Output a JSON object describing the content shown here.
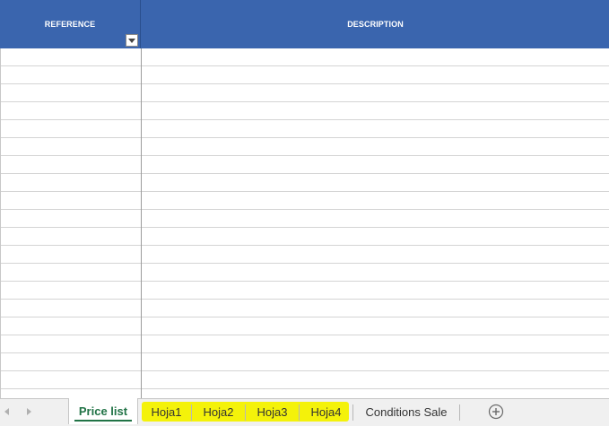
{
  "header": {
    "reference_label": "REFERENCE",
    "description_label": "DESCRIPTION",
    "header_color": "#3a65ae"
  },
  "tabs": {
    "active": "Price list",
    "items": [
      {
        "label": "Price list"
      },
      {
        "label": "Hoja1"
      },
      {
        "label": "Hoja2"
      },
      {
        "label": "Hoja3"
      },
      {
        "label": "Hoja4"
      },
      {
        "label": "Conditions Sale"
      }
    ],
    "highlight_color": "#f4f20a",
    "active_color": "#217346"
  },
  "icons": {
    "filter": "filter-dropdown-icon",
    "nav_left": "chevron-left-icon",
    "nav_right": "chevron-right-icon",
    "add_sheet": "plus-circle-icon"
  }
}
